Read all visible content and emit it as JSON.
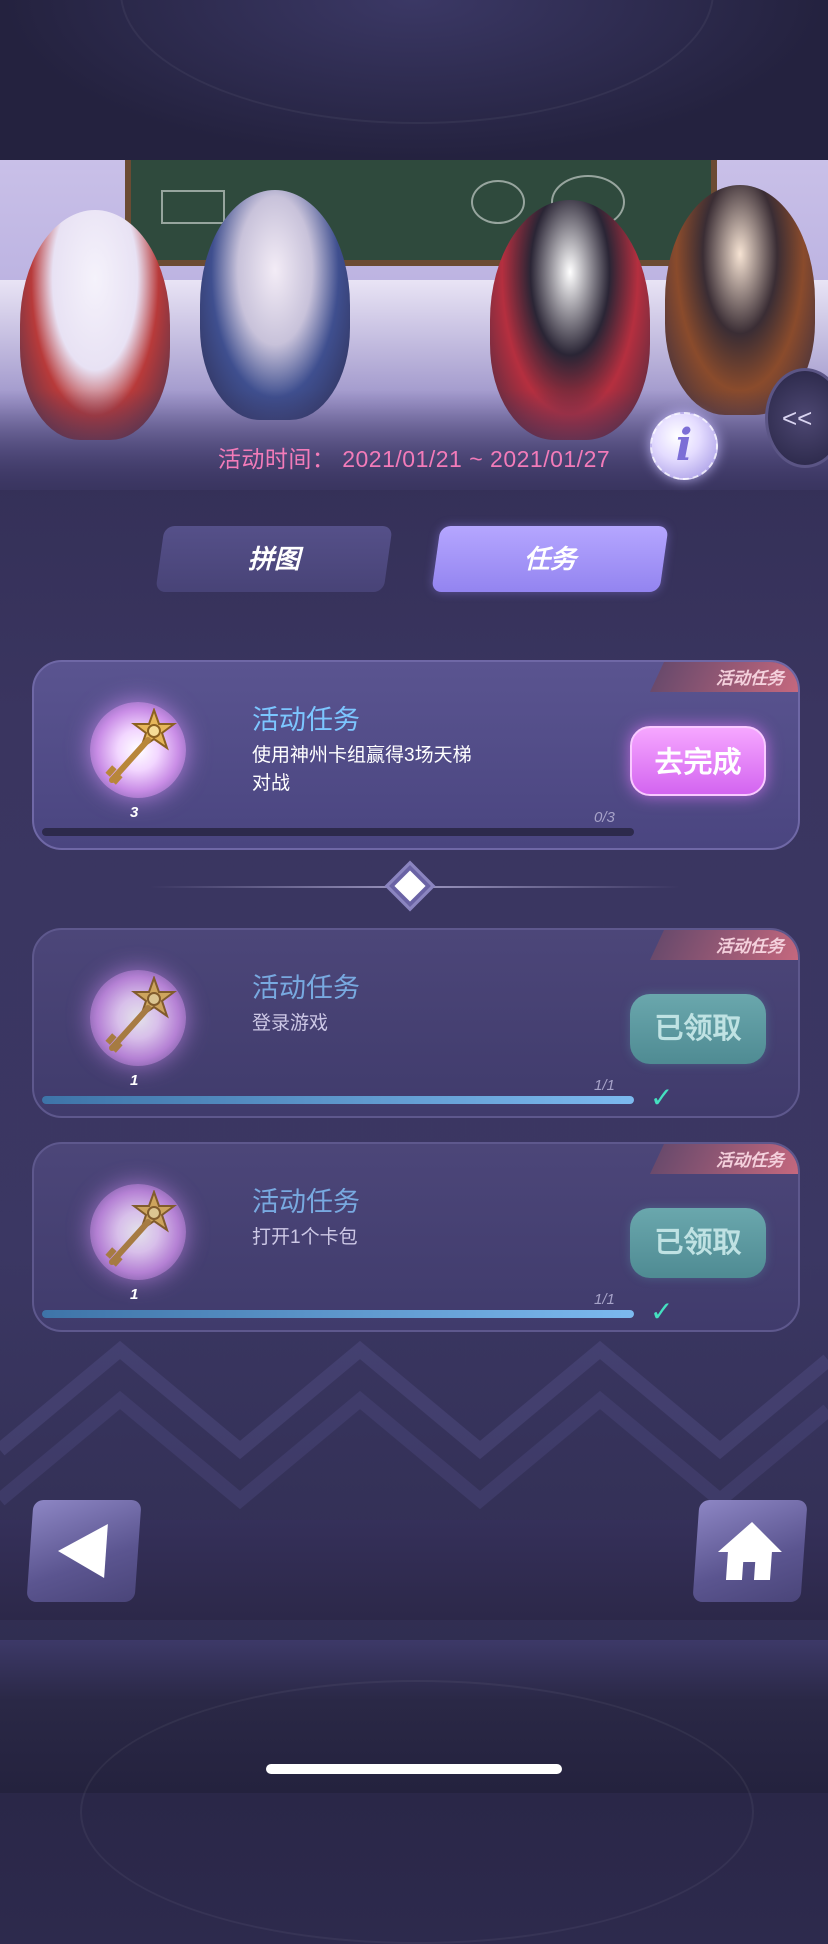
{
  "event": {
    "time_label": "活动时间：",
    "time_range": "2021/01/21 ~ 2021/01/27",
    "info_glyph": "i",
    "side_toggle_glyph": "<<"
  },
  "tabs": [
    {
      "label": "拼图",
      "active": false
    },
    {
      "label": "任务",
      "active": true
    }
  ],
  "tasks": [
    {
      "tag": "活动任务",
      "title": "活动任务",
      "desc": "使用神州卡组赢得3场天梯对战",
      "reward_icon": "key-icon",
      "reward_qty": "3",
      "progress_text": "0/3",
      "progress": 0,
      "button": "去完成",
      "state": "in-progress"
    },
    {
      "tag": "活动任务",
      "title": "活动任务",
      "desc": "登录游戏",
      "reward_icon": "key-icon",
      "reward_qty": "1",
      "progress_text": "1/1",
      "progress": 1,
      "button": "已领取",
      "state": "claimed"
    },
    {
      "tag": "活动任务",
      "title": "活动任务",
      "desc": "打开1个卡包",
      "reward_icon": "key-icon",
      "reward_qty": "1",
      "progress_text": "1/1",
      "progress": 1,
      "button": "已领取",
      "state": "claimed"
    }
  ],
  "nav": {
    "back_icon": "back-arrow-icon",
    "home_icon": "home-icon"
  },
  "colors": {
    "time_text": "#f37bb9",
    "task_title": "#7cc6ff",
    "go_button": "#d365f0",
    "claimed_button": "#4f8b93",
    "check": "#45e0c0"
  }
}
